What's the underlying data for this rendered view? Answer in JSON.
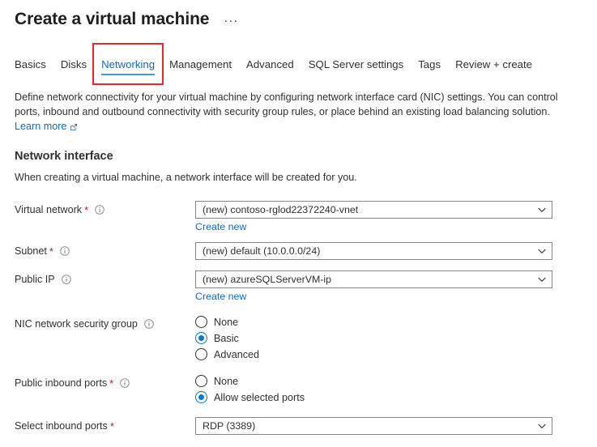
{
  "header": {
    "title": "Create a virtual machine",
    "more_menu": "···"
  },
  "tabs": [
    {
      "label": "Basics",
      "active": false
    },
    {
      "label": "Disks",
      "active": false
    },
    {
      "label": "Networking",
      "active": true,
      "highlighted": true
    },
    {
      "label": "Management",
      "active": false
    },
    {
      "label": "Advanced",
      "active": false
    },
    {
      "label": "SQL Server settings",
      "active": false
    },
    {
      "label": "Tags",
      "active": false
    },
    {
      "label": "Review + create",
      "active": false
    }
  ],
  "intro": {
    "paragraph": "Define network connectivity for your virtual machine by configuring network interface card (NIC) settings. You can control ports, inbound and outbound connectivity with security group rules, or place behind an existing load balancing solution.",
    "learn_more": "Learn more",
    "learn_more_icon": "external-link-icon"
  },
  "section": {
    "title": "Network interface",
    "description": "When creating a virtual machine, a network interface will be created for you."
  },
  "fields": {
    "virtual_network": {
      "label": "Virtual network",
      "required": "*",
      "info_icon": "info-icon",
      "value": "(new) contoso-rglod22372240-vnet",
      "create_new": "Create new"
    },
    "subnet": {
      "label": "Subnet",
      "required": "*",
      "info_icon": "info-icon",
      "value": "(new) default (10.0.0.0/24)"
    },
    "public_ip": {
      "label": "Public IP",
      "info_icon": "info-icon",
      "value": "(new) azureSQLServerVM-ip",
      "create_new": "Create new"
    },
    "nic_nsg": {
      "label": "NIC network security group",
      "info_icon": "info-icon",
      "options": [
        {
          "label": "None",
          "selected": false
        },
        {
          "label": "Basic",
          "selected": true
        },
        {
          "label": "Advanced",
          "selected": false
        }
      ]
    },
    "public_inbound_ports": {
      "label": "Public inbound ports",
      "required": "*",
      "info_icon": "info-icon",
      "options": [
        {
          "label": "None",
          "selected": false
        },
        {
          "label": "Allow selected ports",
          "selected": true
        }
      ]
    },
    "select_inbound_ports": {
      "label": "Select inbound ports",
      "required": "*",
      "value": "RDP (3389)"
    }
  },
  "colors": {
    "accent": "#0078d4",
    "link": "#0f6cbd",
    "required": "#a4262c",
    "highlight_box": "#e8282c",
    "tab_underline": "#4a9ada"
  }
}
